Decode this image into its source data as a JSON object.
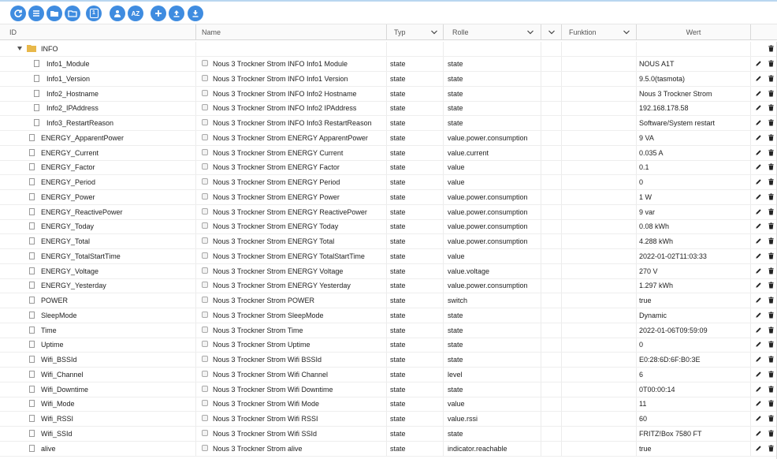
{
  "toolbar": {
    "buttons": [
      "refresh-icon",
      "list-icon",
      "folder-icon",
      "folder-open-icon",
      "counter-badge",
      "users-icon",
      "sort-az-icon",
      "add-icon",
      "upload-icon",
      "download-icon"
    ],
    "counter_label": "1",
    "sort_label": "AZ",
    "accent": "#3f8ce0"
  },
  "header": {
    "id": "ID",
    "name": "Name",
    "typ": "Typ",
    "rolle": "Rolle",
    "funktion": "Funktion",
    "wert": "Wert"
  },
  "folder": {
    "label": "INFO"
  },
  "rows": [
    {
      "id": "Info1_Module",
      "name": "Nous 3 Trockner Strom INFO Info1 Module",
      "typ": "state",
      "rolle": "state",
      "wert": "NOUS A1T"
    },
    {
      "id": "Info1_Version",
      "name": "Nous 3 Trockner Strom INFO Info1 Version",
      "typ": "state",
      "rolle": "state",
      "wert": "9.5.0(tasmota)"
    },
    {
      "id": "Info2_Hostname",
      "name": "Nous 3 Trockner Strom INFO Info2 Hostname",
      "typ": "state",
      "rolle": "state",
      "wert": "Nous 3 Trockner Strom"
    },
    {
      "id": "Info2_IPAddress",
      "name": "Nous 3 Trockner Strom INFO Info2 IPAddress",
      "typ": "state",
      "rolle": "state",
      "wert": "192.168.178.58"
    },
    {
      "id": "Info3_RestartReason",
      "name": "Nous 3 Trockner Strom INFO Info3 RestartReason",
      "typ": "state",
      "rolle": "state",
      "wert": "Software/System restart"
    },
    {
      "id": "ENERGY_ApparentPower",
      "name": "Nous 3 Trockner Strom ENERGY ApparentPower",
      "typ": "state",
      "rolle": "value.power.consumption",
      "wert": "9 VA"
    },
    {
      "id": "ENERGY_Current",
      "name": "Nous 3 Trockner Strom ENERGY Current",
      "typ": "state",
      "rolle": "value.current",
      "wert": "0.035 A"
    },
    {
      "id": "ENERGY_Factor",
      "name": "Nous 3 Trockner Strom ENERGY Factor",
      "typ": "state",
      "rolle": "value",
      "wert": "0.1"
    },
    {
      "id": "ENERGY_Period",
      "name": "Nous 3 Trockner Strom ENERGY Period",
      "typ": "state",
      "rolle": "value",
      "wert": "0"
    },
    {
      "id": "ENERGY_Power",
      "name": "Nous 3 Trockner Strom ENERGY Power",
      "typ": "state",
      "rolle": "value.power.consumption",
      "wert": "1 W"
    },
    {
      "id": "ENERGY_ReactivePower",
      "name": "Nous 3 Trockner Strom ENERGY ReactivePower",
      "typ": "state",
      "rolle": "value.power.consumption",
      "wert": "9 var"
    },
    {
      "id": "ENERGY_Today",
      "name": "Nous 3 Trockner Strom ENERGY Today",
      "typ": "state",
      "rolle": "value.power.consumption",
      "wert": "0.08 kWh"
    },
    {
      "id": "ENERGY_Total",
      "name": "Nous 3 Trockner Strom ENERGY Total",
      "typ": "state",
      "rolle": "value.power.consumption",
      "wert": "4.288 kWh"
    },
    {
      "id": "ENERGY_TotalStartTime",
      "name": "Nous 3 Trockner Strom ENERGY TotalStartTime",
      "typ": "state",
      "rolle": "value",
      "wert": "2022-01-02T11:03:33"
    },
    {
      "id": "ENERGY_Voltage",
      "name": "Nous 3 Trockner Strom ENERGY Voltage",
      "typ": "state",
      "rolle": "value.voltage",
      "wert": "270 V"
    },
    {
      "id": "ENERGY_Yesterday",
      "name": "Nous 3 Trockner Strom ENERGY Yesterday",
      "typ": "state",
      "rolle": "value.power.consumption",
      "wert": "1.297 kWh"
    },
    {
      "id": "POWER",
      "name": "Nous 3 Trockner Strom POWER",
      "typ": "state",
      "rolle": "switch",
      "wert": "true"
    },
    {
      "id": "SleepMode",
      "name": "Nous 3 Trockner Strom SleepMode",
      "typ": "state",
      "rolle": "state",
      "wert": "Dynamic"
    },
    {
      "id": "Time",
      "name": "Nous 3 Trockner Strom Time",
      "typ": "state",
      "rolle": "state",
      "wert": "2022-01-06T09:59:09"
    },
    {
      "id": "Uptime",
      "name": "Nous 3 Trockner Strom Uptime",
      "typ": "state",
      "rolle": "state",
      "wert": "0"
    },
    {
      "id": "Wifi_BSSId",
      "name": "Nous 3 Trockner Strom Wifi BSSId",
      "typ": "state",
      "rolle": "state",
      "wert": "E0:28:6D:6F:B0:3E"
    },
    {
      "id": "Wifi_Channel",
      "name": "Nous 3 Trockner Strom Wifi Channel",
      "typ": "state",
      "rolle": "level",
      "wert": "6"
    },
    {
      "id": "Wifi_Downtime",
      "name": "Nous 3 Trockner Strom Wifi Downtime",
      "typ": "state",
      "rolle": "state",
      "wert": "0T00:00:14"
    },
    {
      "id": "Wifi_Mode",
      "name": "Nous 3 Trockner Strom Wifi Mode",
      "typ": "state",
      "rolle": "value",
      "wert": "11"
    },
    {
      "id": "Wifi_RSSI",
      "name": "Nous 3 Trockner Strom Wifi RSSI",
      "typ": "state",
      "rolle": "value.rssi",
      "wert": "60"
    },
    {
      "id": "Wifi_SSId",
      "name": "Nous 3 Trockner Strom Wifi SSId",
      "typ": "state",
      "rolle": "state",
      "wert": "FRITZ!Box 7580 FT"
    },
    {
      "id": "alive",
      "name": "Nous 3 Trockner Strom alive",
      "typ": "state",
      "rolle": "indicator.reachable",
      "wert": "true"
    }
  ]
}
